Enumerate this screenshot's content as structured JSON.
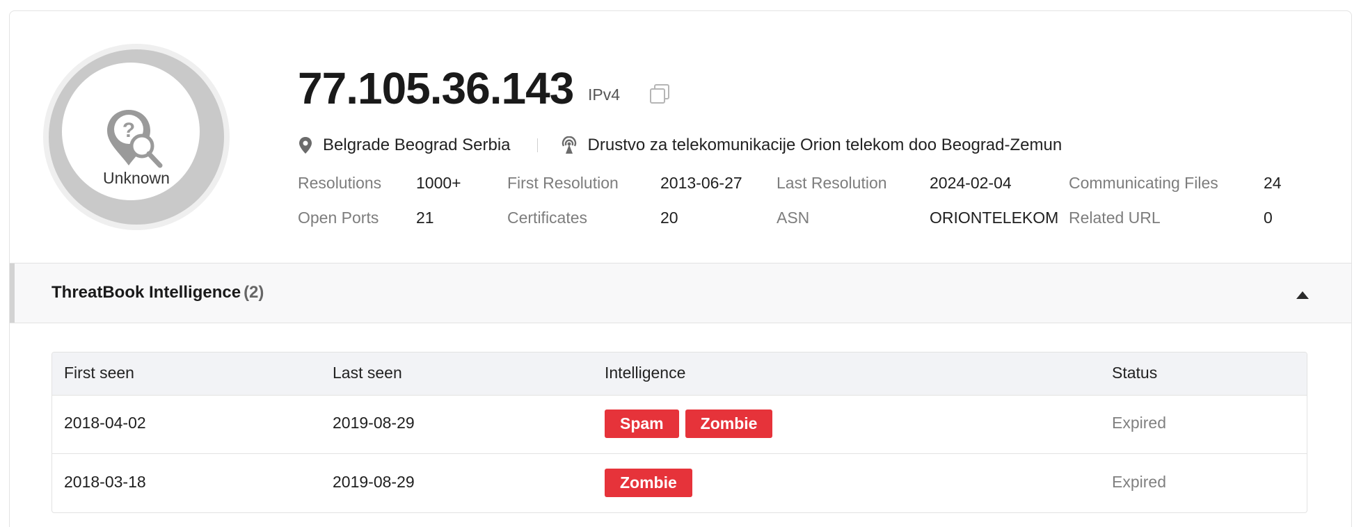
{
  "profile": {
    "ip": "77.105.36.143",
    "ip_type": "IPv4",
    "verdict": "Unknown",
    "location": "Belgrade Beograd Serbia",
    "carrier": "Drustvo za telekomunikacije Orion telekom doo Beograd-Zemun",
    "icons": {
      "verdict": "question-location-icon",
      "copy": "copy-icon",
      "location": "map-pin-icon",
      "carrier": "broadcast-tower-icon"
    }
  },
  "stats": {
    "resolutions": {
      "label": "Resolutions",
      "value": "1000+"
    },
    "first_resolution": {
      "label": "First Resolution",
      "value": "2013-06-27"
    },
    "last_resolution": {
      "label": "Last Resolution",
      "value": "2024-02-04"
    },
    "communicating_files": {
      "label": "Communicating Files",
      "value": "24"
    },
    "open_ports": {
      "label": "Open Ports",
      "value": "21"
    },
    "certificates": {
      "label": "Certificates",
      "value": "20"
    },
    "asn": {
      "label": "ASN",
      "value": "ORIONTELEKOM"
    },
    "related_url": {
      "label": "Related URL",
      "value": "0"
    }
  },
  "intelligence": {
    "title": "ThreatBook Intelligence",
    "count": "(2)",
    "columns": [
      "First seen",
      "Last seen",
      "Intelligence",
      "Status"
    ],
    "rows": [
      {
        "first_seen": "2018-04-02",
        "last_seen": "2019-08-29",
        "tags": [
          "Spam",
          "Zombie"
        ],
        "status": "Expired"
      },
      {
        "first_seen": "2018-03-18",
        "last_seen": "2019-08-29",
        "tags": [
          "Zombie"
        ],
        "status": "Expired"
      }
    ]
  },
  "colors": {
    "tag_red": "#e6333a",
    "ring_gray": "#c9c9c9",
    "muted_text": "#7d7d7d",
    "header_bg": "#f8f8f9"
  }
}
